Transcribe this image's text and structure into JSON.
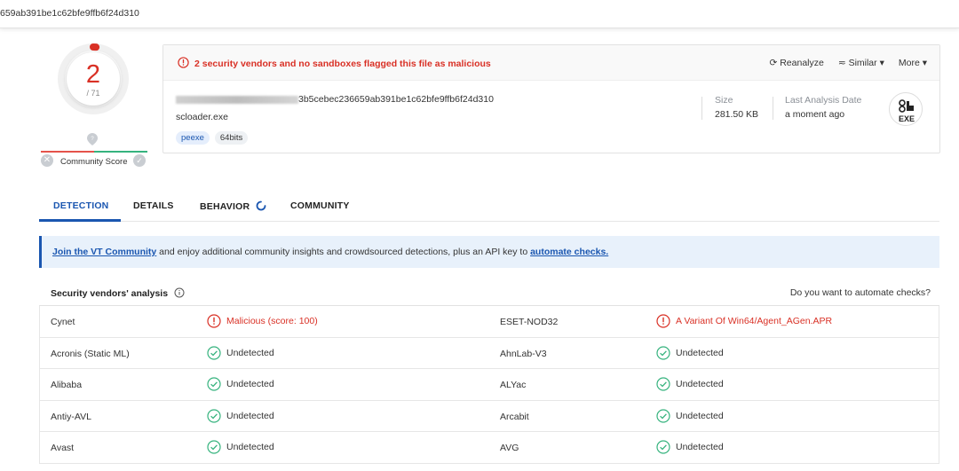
{
  "header": {
    "hash_fragment": "659ab391be1c62bfe9ffb6f24d310"
  },
  "score": {
    "detections": "2",
    "total": "/ 71",
    "detections_count": 2,
    "total_count": 71
  },
  "community": {
    "label": "Community Score"
  },
  "summary": {
    "banner_text": "2 security vendors and no sandboxes flagged this file as malicious",
    "actions": {
      "reanalyze": "Reanalyze",
      "similar": "Similar",
      "more": "More"
    },
    "hash_visible": "3b5cebec236659ab391be1c62bfe9ffb6f24d310",
    "filename": "scloader.exe",
    "tags": [
      "peexe",
      "64bits"
    ],
    "size_label": "Size",
    "size_value": "281.50 KB",
    "last_analysis_label": "Last Analysis Date",
    "last_analysis_value": "a moment ago",
    "file_type": "EXE"
  },
  "tabs": [
    "DETECTION",
    "DETAILS",
    "BEHAVIOR",
    "COMMUNITY"
  ],
  "join": {
    "link1": "Join the VT Community",
    "middle": " and enjoy additional community insights and crowdsourced detections, plus an API key to ",
    "link2": "automate checks."
  },
  "vendors": {
    "title": "Security vendors' analysis",
    "question": "Do you want to automate checks?",
    "rows": [
      {
        "v1": "Cynet",
        "r1": "Malicious (score: 100)",
        "s1": "malicious",
        "v2": "ESET-NOD32",
        "r2": "A Variant Of Win64/Agent_AGen.APR",
        "s2": "malicious"
      },
      {
        "v1": "Acronis (Static ML)",
        "r1": "Undetected",
        "s1": "ok",
        "v2": "AhnLab-V3",
        "r2": "Undetected",
        "s2": "ok"
      },
      {
        "v1": "Alibaba",
        "r1": "Undetected",
        "s1": "ok",
        "v2": "ALYac",
        "r2": "Undetected",
        "s2": "ok"
      },
      {
        "v1": "Antiy-AVL",
        "r1": "Undetected",
        "s1": "ok",
        "v2": "Arcabit",
        "r2": "Undetected",
        "s2": "ok"
      },
      {
        "v1": "Avast",
        "r1": "Undetected",
        "s1": "ok",
        "v2": "AVG",
        "r2": "Undetected",
        "s2": "ok"
      }
    ]
  },
  "colors": {
    "malicious": "#d93025",
    "clean": "#36b37e",
    "accent": "#1a56b0"
  }
}
